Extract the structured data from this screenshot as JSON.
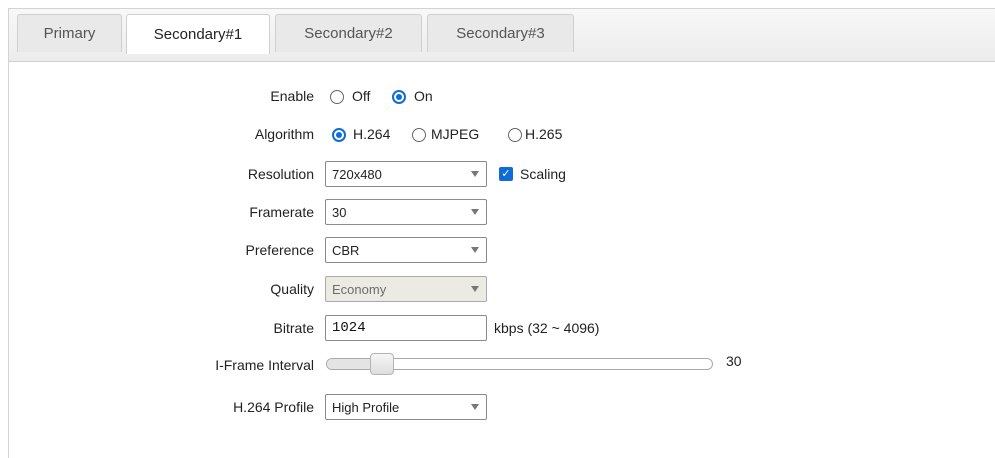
{
  "tabs": [
    {
      "label": "Primary",
      "active": false
    },
    {
      "label": "Secondary#1",
      "active": true
    },
    {
      "label": "Secondary#2",
      "active": false
    },
    {
      "label": "Secondary#3",
      "active": false
    }
  ],
  "form": {
    "enable": {
      "label": "Enable",
      "options": [
        "Off",
        "On"
      ],
      "selected": "On"
    },
    "algorithm": {
      "label": "Algorithm",
      "options": [
        "H.264",
        "MJPEG",
        "H.265"
      ],
      "selected": "H.264"
    },
    "resolution": {
      "label": "Resolution",
      "value": "720x480",
      "scaling_label": "Scaling",
      "scaling_checked": true
    },
    "framerate": {
      "label": "Framerate",
      "value": "30"
    },
    "preference": {
      "label": "Preference",
      "value": "CBR"
    },
    "quality": {
      "label": "Quality",
      "value": "Economy",
      "disabled": true
    },
    "bitrate": {
      "label": "Bitrate",
      "value": "1024",
      "hint": "kbps (32 ~ 4096)"
    },
    "iframe_interval": {
      "label": "I-Frame Interval",
      "value": "30",
      "level_fraction": 0.12
    },
    "h264_profile": {
      "label": "H.264 Profile",
      "value": "High Profile"
    }
  },
  "colors": {
    "accent": "#0f6cd6",
    "disabled_bg": "#ebebe4"
  }
}
